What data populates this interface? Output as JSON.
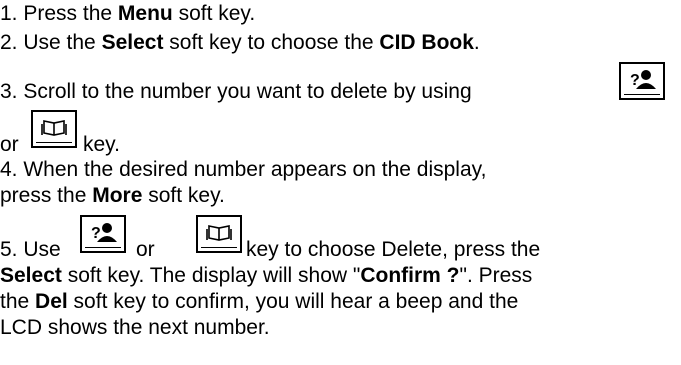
{
  "steps": {
    "s1": {
      "num": "1. ",
      "a": "Press the ",
      "b1": "Menu",
      "c": " soft key."
    },
    "s2": {
      "num": "2. ",
      "a": "Use the ",
      "b1": "Select",
      "c": " soft key to choose the ",
      "b2": "CID Book",
      "d": "."
    },
    "s3": {
      "num": "3. ",
      "a": "Scroll to the number you want to delete by using",
      "or": "or",
      "key_suffix": " key."
    },
    "s4": {
      "line1": "4. When the desired number appears on the display,",
      "line2a": "press the ",
      "b1": "More",
      "line2c": " soft key."
    },
    "s5": {
      "num": "5. ",
      "a": "Use ",
      "or": " or ",
      "after_keys": " key to choose Delete, press the",
      "l2_b1": "Select",
      "l2_a": " soft key. The display will show \"",
      "l2_b2": "Confirm ?",
      "l2_c": "\". Press",
      "l3_a": "the ",
      "l3_b1": "Del",
      "l3_c": " soft key to confirm, you will hear a beep and the",
      "l4": "LCD shows the next number."
    }
  },
  "icons": {
    "caller_id_key": "caller-id-key-icon",
    "phonebook_key": "phonebook-key-icon"
  }
}
